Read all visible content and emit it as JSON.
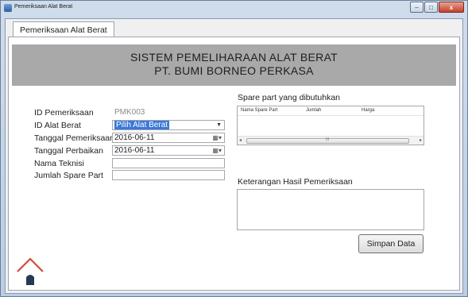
{
  "window": {
    "title": "Pemeriksaan Alat Berat",
    "controls": {
      "minimize": "–",
      "maximize": "□",
      "close": "x"
    }
  },
  "tab": {
    "label": "Pemeriksaan Alat Berat"
  },
  "banner": {
    "line1": "SISTEM PEMELIHARAAN ALAT BERAT",
    "line2": "PT. BUMI BORNEO PERKASA"
  },
  "form": {
    "id_pemeriksaan": {
      "label": "ID Pemeriksaan",
      "value": "PMK003"
    },
    "id_alat_berat": {
      "label": "ID Alat Berat",
      "value": "Pilih Alat Berat"
    },
    "tanggal_pemeriksaan": {
      "label": "Tanggal Pemeriksaan",
      "value": "2016-06-11"
    },
    "tanggal_perbaikan": {
      "label": "Tanggal Perbaikan",
      "value": "2016-06-11"
    },
    "nama_teknisi": {
      "label": "Nama Teknisi",
      "value": ""
    },
    "jumlah_spare_part": {
      "label": "Jumlah Spare Part",
      "value": ""
    }
  },
  "spare_parts": {
    "title": "Spare part yang dibutuhkan",
    "columns": [
      "Nama Spare Part",
      "Jumlah",
      "Harga"
    ]
  },
  "keterangan": {
    "label": "Keterangan Hasil Pemeriksaan",
    "value": ""
  },
  "save_button": {
    "label": "Simpan Data"
  },
  "colors": {
    "banner": "#a9a9a9",
    "selection": "#3b78d8",
    "home_roof": "#d24b3c",
    "home_door": "#243a56"
  }
}
